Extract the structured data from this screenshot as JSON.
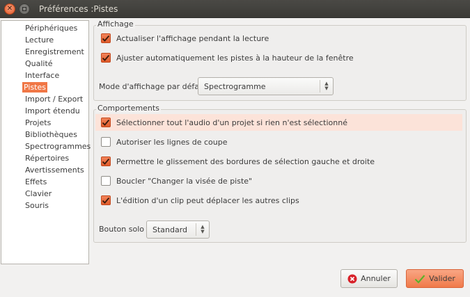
{
  "window": {
    "title": "Préférences :Pistes"
  },
  "sidebar": {
    "selected_index": 5,
    "items": [
      {
        "label": "Périphériques"
      },
      {
        "label": "Lecture"
      },
      {
        "label": "Enregistrement"
      },
      {
        "label": "Qualité"
      },
      {
        "label": "Interface"
      },
      {
        "label": "Pistes"
      },
      {
        "label": "Import / Export"
      },
      {
        "label": "Import étendu"
      },
      {
        "label": "Projets"
      },
      {
        "label": "Bibliothèques"
      },
      {
        "label": "Spectrogrammes"
      },
      {
        "label": "Répertoires"
      },
      {
        "label": "Avertissements"
      },
      {
        "label": "Effets"
      },
      {
        "label": "Clavier"
      },
      {
        "label": "Souris"
      }
    ]
  },
  "affichage": {
    "title": "Affichage",
    "options": [
      {
        "label": "Actualiser l'affichage pendant la lecture",
        "checked": true
      },
      {
        "label": "Ajuster automatiquement les pistes à la hauteur de la fenêtre",
        "checked": true
      }
    ],
    "mode_label": "Mode d'affichage par défaut",
    "mode_value": "Spectrogramme"
  },
  "comportements": {
    "title": "Comportements",
    "options": [
      {
        "label": "Sélectionner tout l'audio d'un projet si rien n'est sélectionné",
        "checked": true
      },
      {
        "label": "Autoriser les lignes de coupe",
        "checked": false
      },
      {
        "label": "Permettre le glissement des bordures de sélection gauche et droite",
        "checked": true
      },
      {
        "label": "Boucler \"Changer la visée de piste\"",
        "checked": false
      },
      {
        "label": "L'édition d'un clip peut déplacer les autres clips",
        "checked": true
      }
    ],
    "solo_label": "Bouton solo :",
    "solo_value": "Standard"
  },
  "buttons": {
    "cancel_label": "Annuler",
    "ok_label": "Valider"
  },
  "colors": {
    "accent": "#f07746",
    "highlight_row": "#fce3d9"
  }
}
